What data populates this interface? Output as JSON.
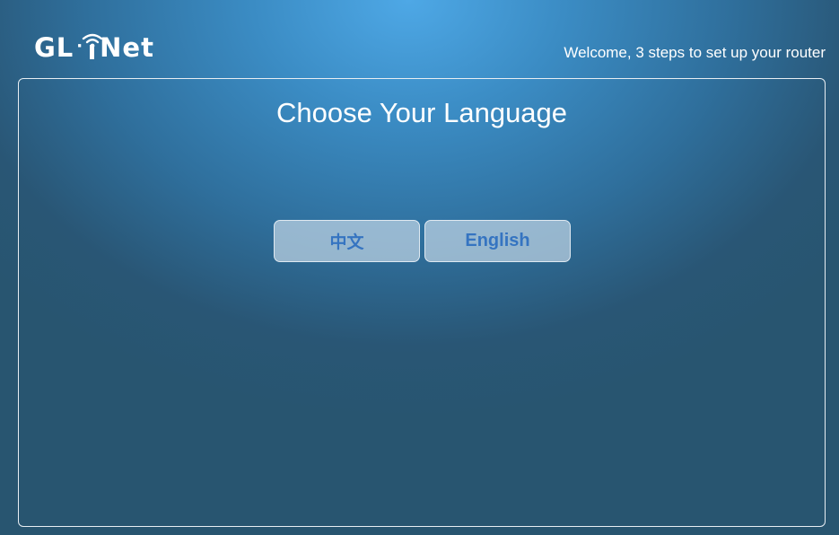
{
  "header": {
    "logo": {
      "text_left": "GL",
      "separator": "·",
      "text_right": "Net"
    },
    "welcome": "Welcome, 3 steps to set up your router"
  },
  "panel": {
    "title": "Choose Your Language",
    "languages": [
      {
        "label": "中文"
      },
      {
        "label": "English"
      }
    ]
  },
  "colors": {
    "background_light": "#4ea8e6",
    "background_dark": "#285570",
    "button_text": "#3574c1"
  }
}
